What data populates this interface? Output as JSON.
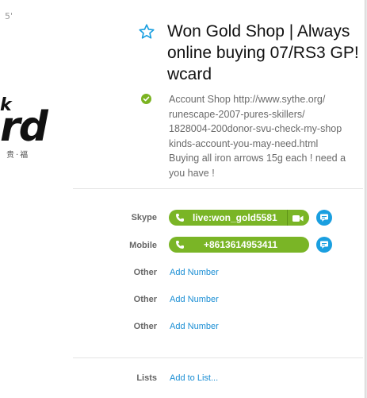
{
  "background_fragment": {
    "line1": "5'",
    "line2": "k",
    "line3": "rd",
    "line4": "贵·福"
  },
  "profile": {
    "display_name": "Won Gold Shop | Always online buying 07/RS3 GP! wcard",
    "mood_lines": [
      "Account Shop http://www.sythe.org/",
      "runescape-2007-pures-skillers/",
      "1828004-200donor-svu-check-my-shop",
      "kinds-account-you-may-need.html",
      "Buying all iron arrows 15g each ! need a",
      "you have !"
    ]
  },
  "contacts": {
    "skype": {
      "label": "Skype",
      "value": "live:won_gold5581"
    },
    "mobile": {
      "label": "Mobile",
      "value": "+8613614953411"
    },
    "other1": {
      "label": "Other",
      "action": "Add Number"
    },
    "other2": {
      "label": "Other",
      "action": "Add Number"
    },
    "other3": {
      "label": "Other",
      "action": "Add Number"
    },
    "lists": {
      "label": "Lists",
      "action": "Add to List..."
    }
  },
  "colors": {
    "accent_green": "#7ab526",
    "link_blue": "#1a8ed4",
    "chat_blue": "#1a9fe0",
    "star_blue": "#1a9fe0"
  },
  "icons": [
    "star-icon",
    "mood-check-icon",
    "phone-icon",
    "video-icon",
    "chat-icon"
  ]
}
